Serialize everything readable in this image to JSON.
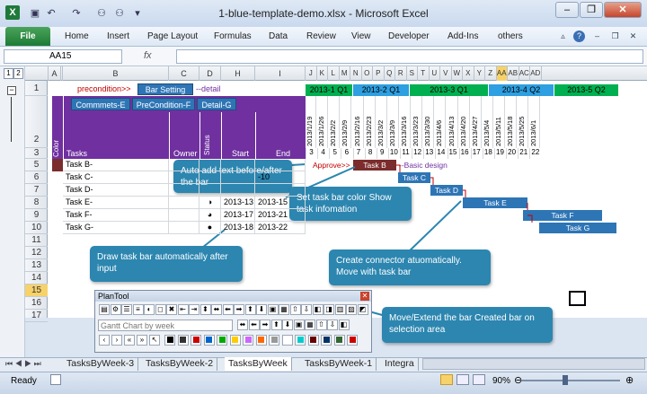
{
  "window": {
    "title": "1-blue-template-demo.xlsx - Microsoft Excel",
    "app_icon": "X"
  },
  "ribbon": {
    "file": "File",
    "tabs": [
      "Home",
      "Insert",
      "Page Layout",
      "Formulas",
      "Data",
      "Review",
      "View",
      "Developer",
      "Add-Ins",
      "others"
    ]
  },
  "formula": {
    "name_box": "AA15",
    "fx": "fx",
    "value": ""
  },
  "outline_levels": [
    "1",
    "2"
  ],
  "columns": [
    "A",
    "AA",
    "B",
    "C",
    "D",
    "H",
    "I",
    "J",
    "K",
    "L",
    "M",
    "N",
    "O",
    "P",
    "Q",
    "R",
    "S",
    "T",
    "U",
    "V",
    "W",
    "X",
    "Y",
    "Z",
    "AA",
    "AB",
    "AC",
    "AD"
  ],
  "rows": [
    "1",
    "2",
    "3",
    "5",
    "6",
    "7",
    "8",
    "9",
    "10",
    "11",
    "12",
    "13",
    "14",
    "15",
    "16",
    "17",
    "18"
  ],
  "sheet": {
    "precondition": "precondition>>",
    "bar_setting": "Bar Setting",
    "detail": "--detail",
    "btn_comments": "Commmets-E",
    "btn_precondition": "PreCondition-F",
    "btn_detail": "Detail-G",
    "hdr_color": "Color",
    "hdr_tasks": "Tasks",
    "hdr_owner": "Owner",
    "hdr_status": "Status",
    "hdr_start": "Start",
    "hdr_end": "End",
    "quarters": [
      "2013-1 Q1",
      "2013-2 Q1",
      "2013-3 Q1",
      "2013-4 Q2",
      "2013-5 Q2"
    ],
    "dates": [
      "2013/1/19",
      "2013/1/26",
      "2013/2/2",
      "2013/2/9",
      "2013/2/16",
      "2013/2/23",
      "2013/3/2",
      "2013/3/9",
      "2013/3/16",
      "2013/3/23",
      "2013/3/30",
      "2013/4/6",
      "2013/4/13",
      "2013/4/20",
      "2013/4/27",
      "2013/5/4",
      "2013/5/11",
      "2013/5/18",
      "2013/5/25",
      "2013/6/1"
    ],
    "week_nums": [
      "3",
      "4",
      "5",
      "6",
      "7",
      "8",
      "9",
      "10",
      "11",
      "12",
      "13",
      "14",
      "15",
      "16",
      "17",
      "18",
      "19",
      "20",
      "21",
      "22"
    ],
    "tasks": [
      {
        "name": "Task B-",
        "start": "",
        "end": ""
      },
      {
        "name": "Task C-",
        "start": "",
        "end": "-10"
      },
      {
        "name": "Task D-",
        "start": "",
        "end": ""
      },
      {
        "name": "Task E-",
        "start": "2013-13",
        "end": "2013-15"
      },
      {
        "name": "Task F-",
        "start": "2013-17",
        "end": "2013-21"
      },
      {
        "name": "Task G-",
        "start": "2013-18",
        "end": "2013-22"
      }
    ],
    "approve": "Approve>>",
    "basic_design": "--Basic design",
    "bars": [
      "Task B",
      "Task C",
      "Task D",
      "Task E",
      "Task F",
      "Task G"
    ]
  },
  "callouts": {
    "auto_text": "Auto add text before/after the bar",
    "set_color": "Set task bar color Show task infomation",
    "draw_bar": "Draw task bar automatically after input",
    "connector": "Create connector atuomatically. Move with task bar",
    "move_extend": "Move/Extend the bar Created bar on selection area"
  },
  "plantool": {
    "title": "PlanTool",
    "field": "Gantt Chart by week"
  },
  "sheet_tabs": [
    "TasksByWeek-3",
    "TasksByWeek-2",
    "TasksByWeek",
    "TasksByWeek-1",
    "Integra"
  ],
  "status": {
    "ready": "Ready",
    "zoom": "90%"
  },
  "colors": {
    "purple": "#7030a0",
    "blue": "#2e75b6",
    "green": "#00b050",
    "dark_red": "#7b2c2c",
    "callout": "#2c86b0"
  }
}
